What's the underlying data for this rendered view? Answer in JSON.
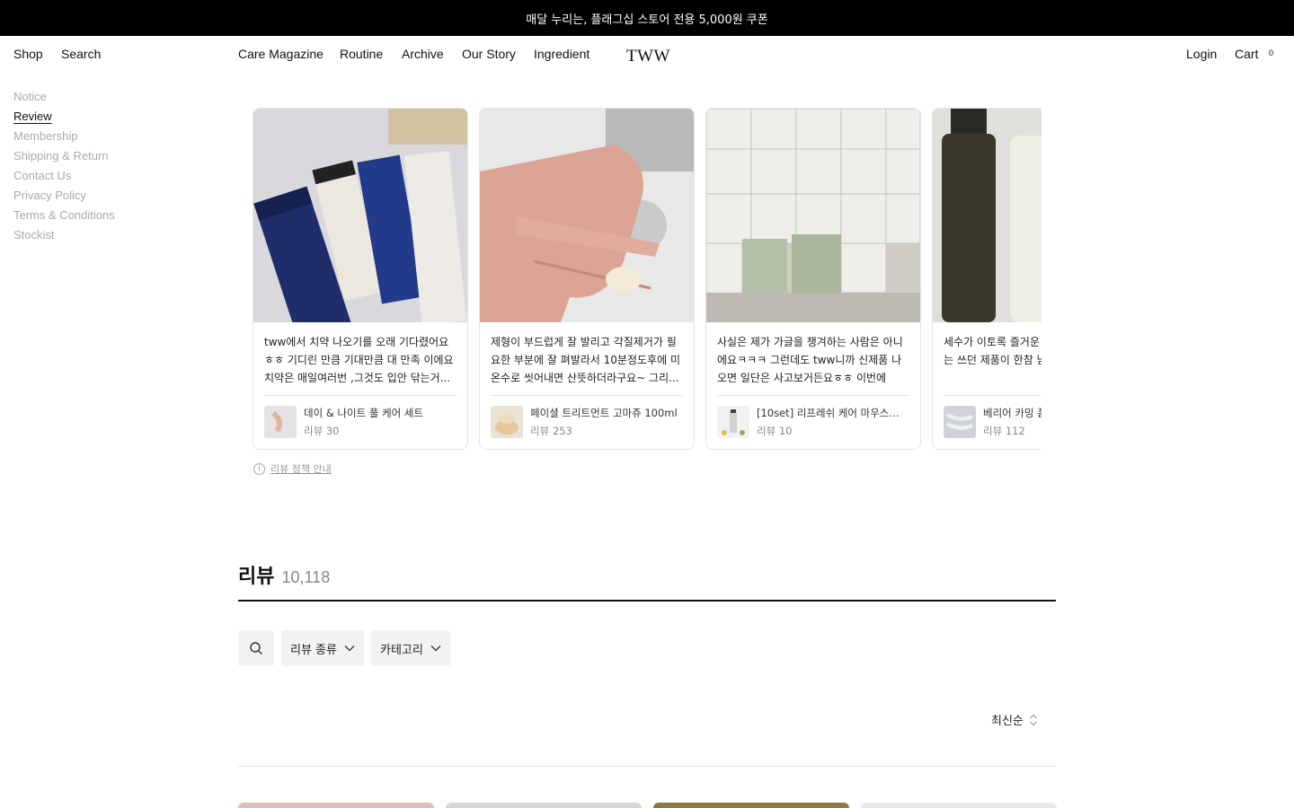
{
  "announcement": "매달 누리는, 플래그십 스토어 전용 5,000원 쿠폰",
  "nav": {
    "shop": "Shop",
    "search": "Search",
    "care_magazine": "Care Magazine",
    "routine": "Routine",
    "archive": "Archive",
    "our_story": "Our Story",
    "ingredient": "Ingredient",
    "logo": "TWW",
    "login": "Login",
    "cart": "Cart",
    "cart_count": "0"
  },
  "sidebar": {
    "items": [
      {
        "label": "Notice",
        "active": false
      },
      {
        "label": "Review",
        "active": true
      },
      {
        "label": "Membership",
        "active": false
      },
      {
        "label": "Shipping & Return",
        "active": false
      },
      {
        "label": "Contact Us",
        "active": false
      },
      {
        "label": "Privacy Policy",
        "active": false
      },
      {
        "label": "Terms & Conditions",
        "active": false
      },
      {
        "label": "Stockist",
        "active": false
      }
    ]
  },
  "best_reviews": [
    {
      "text": "tww에서 치약 나오기를 오래 기다렸어요 ㅎㅎ 기디린 만큼 기대만큼 대 만족 이에요 치약은 매일여러번 ,그것도 입안 닦는거...",
      "product": "데이 & 나이트 풀 케어 세트",
      "review_count": "리뷰 30"
    },
    {
      "text": "제형이 부드럽게 잘 발리고 각질제거가 필요한 부분에 잘 펴발라서 10분정도후에 미온수로 씻어내면 산뜻하더라구요~ 그리...",
      "product": "페이셜 트리트먼트 고마쥬 100ml",
      "review_count": "리뷰 253"
    },
    {
      "text": "사실은 제가 가글을 챙겨하는 사람은 아니에요ㅋㅋㅋ 그런데도 tww니까 신제품 나오면 일단은 사고보거든요ㅎㅎ 이번에 운...",
      "product": "[10set] 리프레쉬 케어 마우스워시...",
      "review_count": "리뷰 10"
    },
    {
      "text": "세수가 이토록 즐거운 조합이네요. 클렌저는 쓰던 제품이 한참 남이...",
      "product": "베리어 카밍 폼",
      "review_count": "리뷰 112"
    }
  ],
  "policy_link": "리뷰 정책 안내",
  "review_section": {
    "title": "리뷰",
    "count": "10,118"
  },
  "filters": {
    "review_type": "리뷰 종류",
    "category": "카테고리"
  },
  "sort": {
    "label": "최신순"
  },
  "icons": {
    "search": "search-icon",
    "chevron": "chevron-down-icon",
    "sort": "sort-updown-icon",
    "info": "info-icon"
  },
  "colors": {
    "announcement_bg": "#000000",
    "inactive_link": "#aaaaaa",
    "filter_bg": "#f2f2f2"
  }
}
